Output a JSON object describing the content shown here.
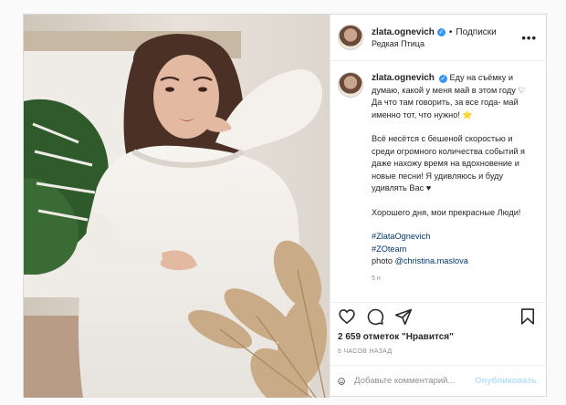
{
  "post": {
    "username": "zlata.ognevich",
    "follow_label": "Подписки",
    "location": "Редкая Птица",
    "more_label": "•••",
    "caption": {
      "line1": "Еду на съёмку и думаю, какой у меня май в этом году ♡ Да что там говорить, за все года- май именно тот, что нужно! ⭐",
      "para2": "Всё несётся с бешеной скоростью и среди огромного количества событий я даже нахожу время на вдохновение и новые песни! Я удивляюсь и буду удивлять Вас ♥",
      "para3": "Хорошего дня, мои прекрасные Люди!",
      "hashtag1": "#ZlataOgnevich",
      "hashtag2": "#ZOteam",
      "photo_credit_prefix": "photo ",
      "photo_credit_handle": "@christina.maslova",
      "age": "5 н"
    },
    "likes": "2 659 отметок \"Нравится\"",
    "time": "6 ЧАСОВ НАЗАД",
    "comment_placeholder": "Добавьте комментарий...",
    "publish_label": "Опубликовать"
  },
  "icons": {
    "like": "heart-icon",
    "comment": "comment-icon",
    "share": "share-icon",
    "save": "bookmark-icon",
    "emoji": "emoji-icon",
    "verified": "verified-badge-icon"
  },
  "colors": {
    "link": "#00376b",
    "verified": "#3897f0",
    "publish_disabled": "#b2dffc",
    "secondary_text": "#8e8e8e"
  }
}
